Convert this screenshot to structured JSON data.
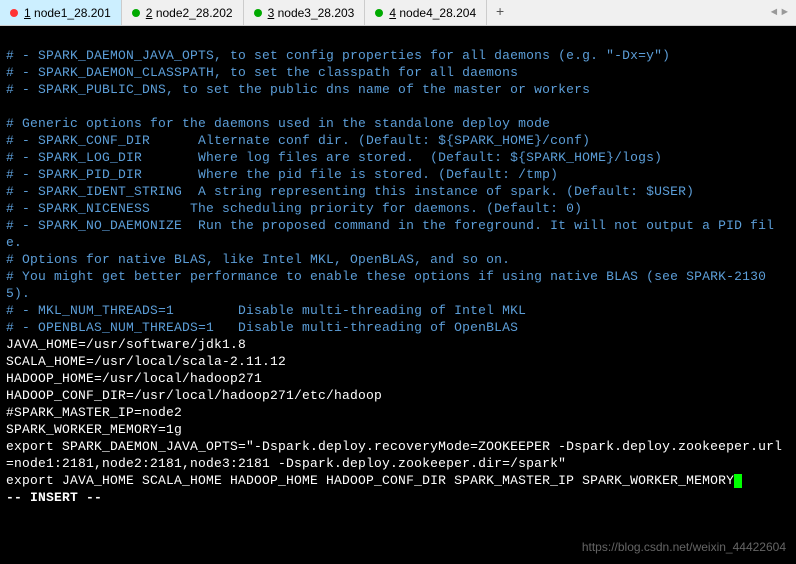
{
  "tabs": [
    {
      "num": "1",
      "label": "node1_28.201",
      "active": true,
      "dot": "red"
    },
    {
      "num": "2",
      "label": "node2_28.202",
      "active": false,
      "dot": "green"
    },
    {
      "num": "3",
      "label": "node3_28.203",
      "active": false,
      "dot": "green"
    },
    {
      "num": "4",
      "label": "node4_28.204",
      "active": false,
      "dot": "green"
    }
  ],
  "content": {
    "l1": "# - SPARK_DAEMON_JAVA_OPTS, to set config properties for all daemons (e.g. \"-Dx=y\")",
    "l2": "# - SPARK_DAEMON_CLASSPATH, to set the classpath for all daemons",
    "l3": "# - SPARK_PUBLIC_DNS, to set the public dns name of the master or workers",
    "l4": "",
    "l5": "# Generic options for the daemons used in the standalone deploy mode",
    "l6": "# - SPARK_CONF_DIR      Alternate conf dir. (Default: ${SPARK_HOME}/conf)",
    "l7": "# - SPARK_LOG_DIR       Where log files are stored.  (Default: ${SPARK_HOME}/logs)",
    "l8": "# - SPARK_PID_DIR       Where the pid file is stored. (Default: /tmp)",
    "l9": "# - SPARK_IDENT_STRING  A string representing this instance of spark. (Default: $USER)",
    "l10": "# - SPARK_NICENESS     The scheduling priority for daemons. (Default: 0)",
    "l11": "# - SPARK_NO_DAEMONIZE  Run the proposed command in the foreground. It will not output a PID file.",
    "l12": "# Options for native BLAS, like Intel MKL, OpenBLAS, and so on.",
    "l13": "# You might get better performance to enable these options if using native BLAS (see SPARK-21305).",
    "l14": "# - MKL_NUM_THREADS=1        Disable multi-threading of Intel MKL",
    "l15": "# - OPENBLAS_NUM_THREADS=1   Disable multi-threading of OpenBLAS",
    "l16": "JAVA_HOME=/usr/software/jdk1.8",
    "l17": "SCALA_HOME=/usr/local/scala-2.11.12",
    "l18": "HADOOP_HOME=/usr/local/hadoop271",
    "l19": "HADOOP_CONF_DIR=/usr/local/hadoop271/etc/hadoop",
    "l20": "#SPARK_MASTER_IP=node2",
    "l21": "SPARK_WORKER_MEMORY=1g",
    "l22": "export SPARK_DAEMON_JAVA_OPTS=\"-Dspark.deploy.recoveryMode=ZOOKEEPER -Dspark.deploy.zookeeper.url=node1:2181,node2:2181,node3:2181 -Dspark.deploy.zookeeper.dir=/spark\"",
    "l23": "export JAVA_HOME SCALA_HOME HADOOP_HOME HADOOP_CONF_DIR SPARK_MASTER_IP SPARK_WORKER_MEMORY"
  },
  "status": "-- INSERT --",
  "watermark": "https://blog.csdn.net/weixin_44422604"
}
